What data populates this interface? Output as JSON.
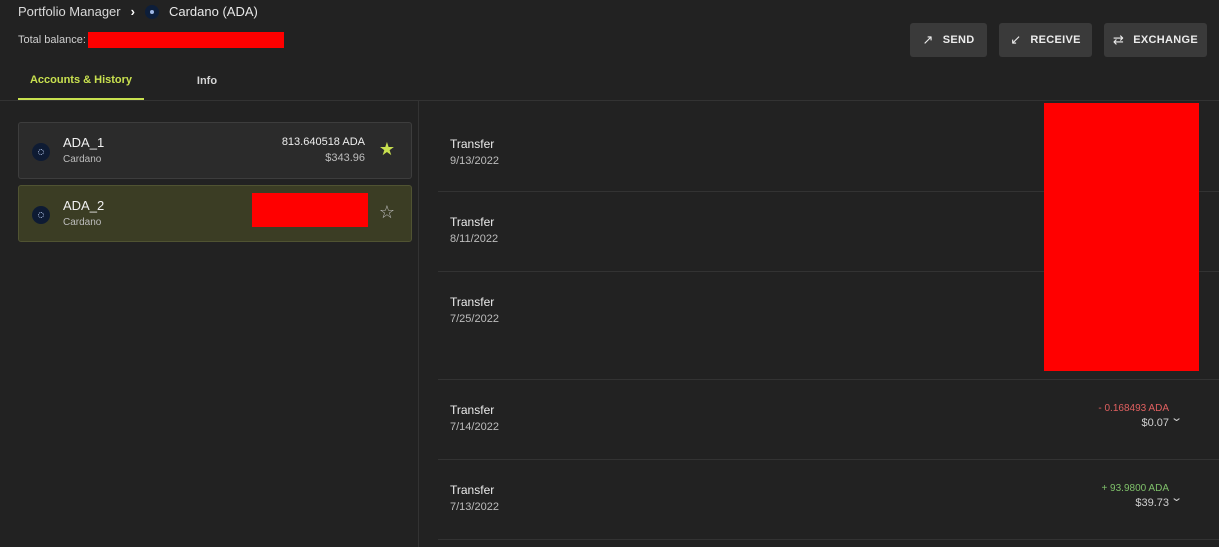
{
  "header": {
    "breadcrumb_root": "Portfolio Manager",
    "breadcrumb_sep": "›",
    "breadcrumb_current": "Cardano (ADA)",
    "total_balance_label": "Total balance:"
  },
  "actions": {
    "send": {
      "label": "SEND",
      "icon": "↗"
    },
    "receive": {
      "label": "RECEIVE",
      "icon": "↙"
    },
    "exchange": {
      "label": "EXCHANGE",
      "icon": "⇄"
    }
  },
  "tabs": [
    {
      "label": "Accounts & History",
      "active": true
    },
    {
      "label": "Info",
      "active": false
    }
  ],
  "accounts": [
    {
      "name": "ADA_1",
      "network": "Cardano",
      "amount": "813.640518 ADA",
      "fiat": "$343.96",
      "favorite": true
    },
    {
      "name": "ADA_2",
      "network": "Cardano",
      "amount": "",
      "fiat": "",
      "favorite": false
    }
  ],
  "transactions": [
    {
      "title": "Transfer",
      "date": "9/13/2022",
      "amount": "",
      "fiat": ""
    },
    {
      "title": "Transfer",
      "date": "8/11/2022",
      "amount": "",
      "fiat": ""
    },
    {
      "title": "Transfer",
      "date": "7/25/2022",
      "amount": "",
      "fiat": ""
    },
    {
      "title": "Transfer",
      "date": "7/14/2022",
      "amount": "- 0.168493 ADA",
      "fiat": "$0.07"
    },
    {
      "title": "Transfer",
      "date": "7/13/2022",
      "amount": "+ 93.9800 ADA",
      "fiat": "$39.73"
    }
  ],
  "colors": {
    "accent": "#c8e04f",
    "negative": "#e06060",
    "positive": "#7fc06a",
    "redaction": "#ff0000"
  },
  "icons": {
    "star_filled": "★",
    "star_empty": "☆",
    "chevron": "⌄"
  }
}
